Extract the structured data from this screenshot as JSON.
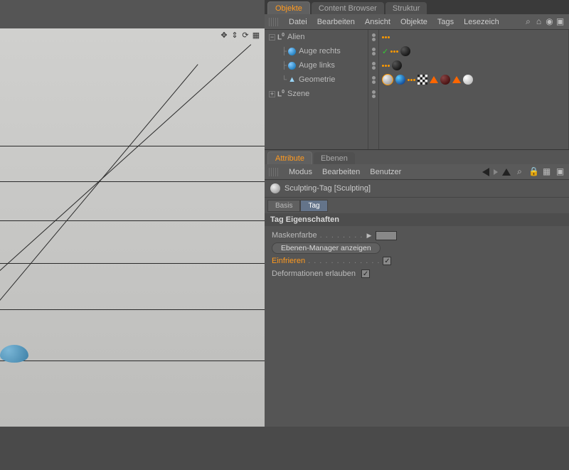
{
  "top_tabs": {
    "objects": "Objekte",
    "content_browser": "Content Browser",
    "structure": "Struktur"
  },
  "obj_menu": {
    "file": "Datei",
    "edit": "Bearbeiten",
    "view": "Ansicht",
    "objects": "Objekte",
    "tags": "Tags",
    "bookmark": "Lesezeich"
  },
  "tree": {
    "alien": "Alien",
    "eye_right": "Auge rechts",
    "eye_left": "Auge links",
    "geometry": "Geometrie",
    "scene": "Szene"
  },
  "attr_tabs": {
    "attributes": "Attribute",
    "layers": "Ebenen"
  },
  "attr_menu": {
    "mode": "Modus",
    "edit": "Bearbeiten",
    "user": "Benutzer"
  },
  "attr_header": "Sculpting-Tag [Sculpting]",
  "sub_tabs": {
    "basis": "Basis",
    "tag": "Tag"
  },
  "section": "Tag Eigenschaften",
  "props": {
    "mask_color": "Maskenfarbe",
    "layer_mgr_btn": "Ebenen-Manager anzeigen",
    "freeze": "Einfrieren",
    "allow_deform": "Deformationen erlauben"
  }
}
